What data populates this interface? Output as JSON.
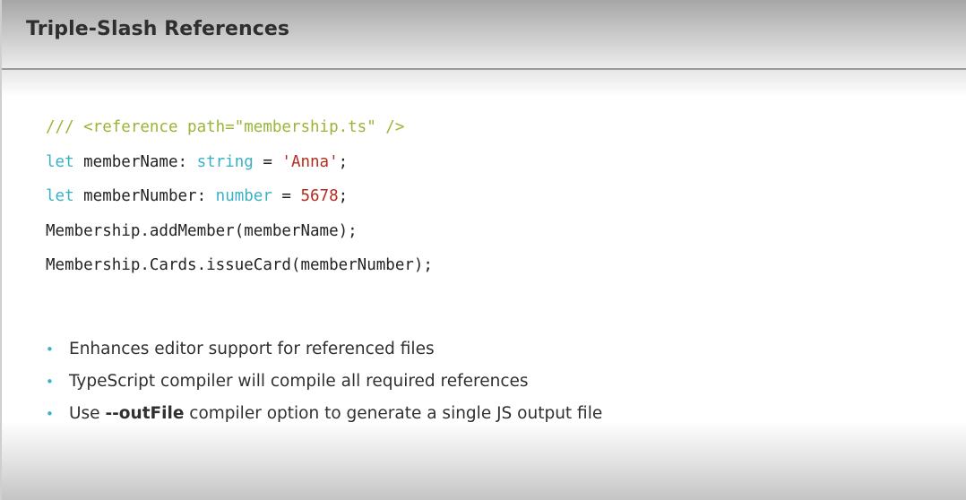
{
  "slide": {
    "title": "Triple-Slash References",
    "colors": {
      "comment": "#9ab536",
      "keyword": "#3ab0c6",
      "string": "#b52a1d",
      "bullet": "#3ab0c6"
    }
  },
  "code": {
    "line1": {
      "comment": "/// <reference path=\"membership.ts\" />"
    },
    "line2": {
      "kw": "let",
      "name": " memberName: ",
      "type": "string",
      "eq": " = ",
      "value": "'Anna'",
      "end": ";"
    },
    "line3": {
      "kw": "let",
      "name": " memberNumber: ",
      "type": "number",
      "eq": " = ",
      "value": "5678",
      "end": ";"
    },
    "line4": {
      "text": "Membership.addMember(memberName);"
    },
    "line5": {
      "text": "Membership.Cards.issueCard(memberNumber);"
    }
  },
  "bullets": {
    "marker": "•",
    "items": [
      {
        "text": "Enhances editor support for referenced files"
      },
      {
        "text": "TypeScript compiler will compile all required references"
      },
      {
        "pre": "Use ",
        "strong": "--outFile",
        "post": " compiler option to generate a single JS output file"
      }
    ]
  }
}
